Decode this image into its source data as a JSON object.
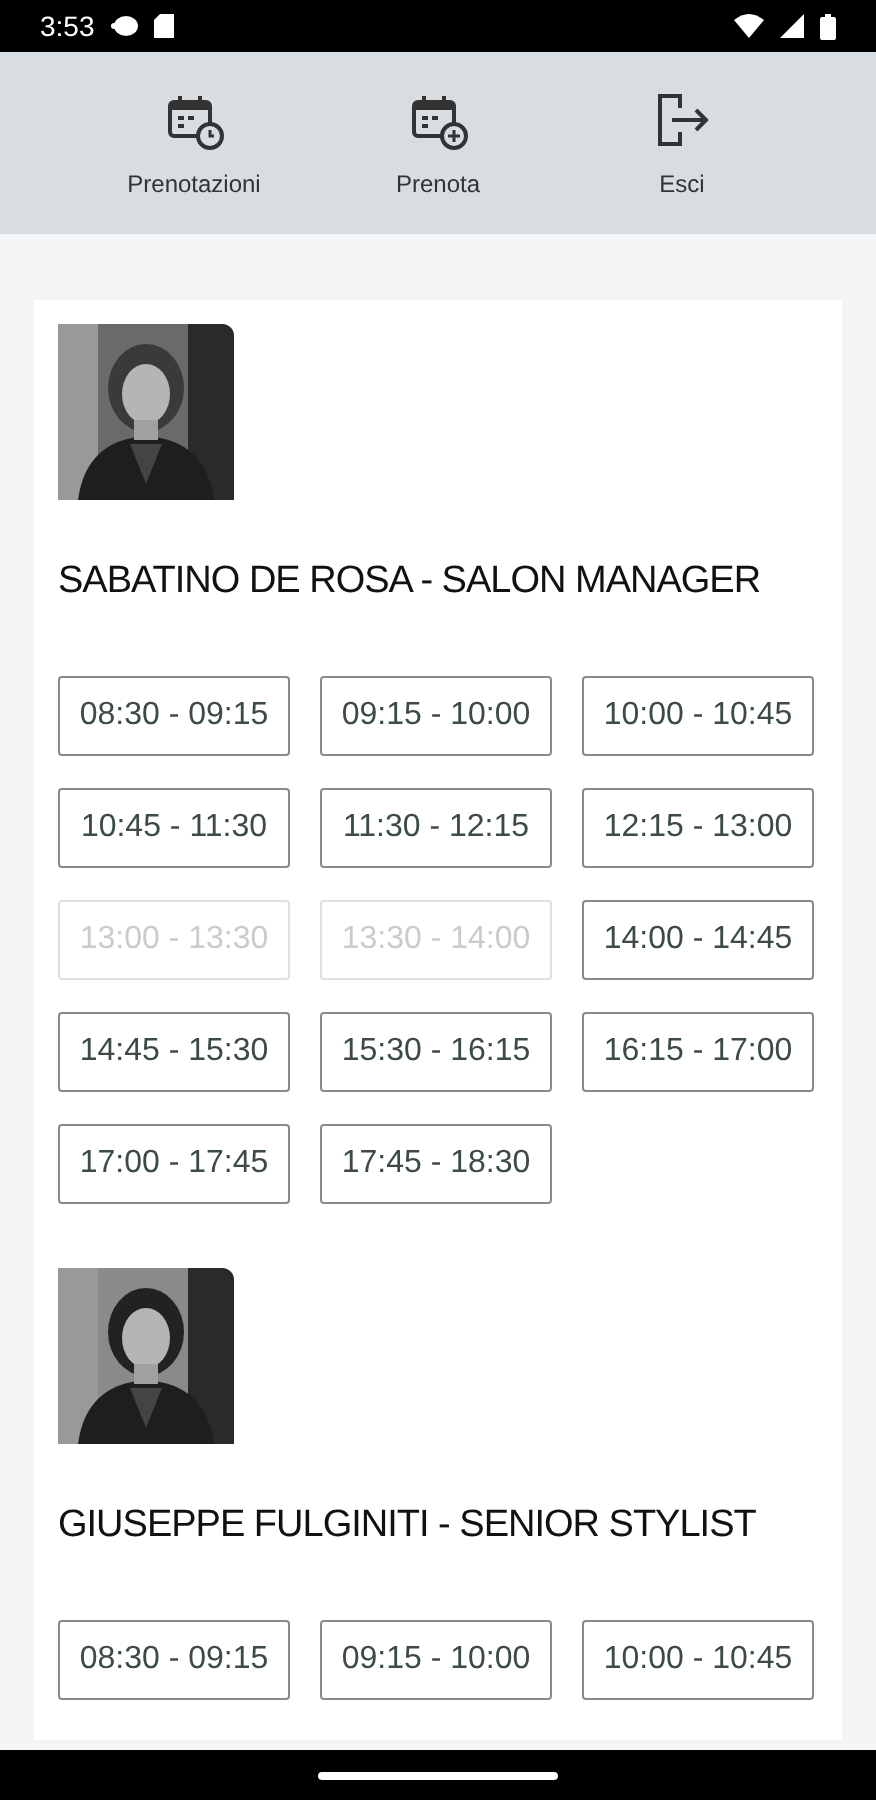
{
  "status_bar": {
    "time": "3:53"
  },
  "nav": [
    {
      "label": "Prenotazioni",
      "kind": "bookings"
    },
    {
      "label": "Prenota",
      "kind": "book"
    },
    {
      "label": "Esci",
      "kind": "logout"
    }
  ],
  "stylists": [
    {
      "name": "SABATINO DE ROSA - SALON MANAGER",
      "slots": [
        {
          "label": "08:30 - 09:15",
          "disabled": false
        },
        {
          "label": "09:15 - 10:00",
          "disabled": false
        },
        {
          "label": "10:00 - 10:45",
          "disabled": false
        },
        {
          "label": "10:45 - 11:30",
          "disabled": false
        },
        {
          "label": "11:30 - 12:15",
          "disabled": false
        },
        {
          "label": "12:15 - 13:00",
          "disabled": false
        },
        {
          "label": "13:00 - 13:30",
          "disabled": true
        },
        {
          "label": "13:30 - 14:00",
          "disabled": true
        },
        {
          "label": "14:00 - 14:45",
          "disabled": false
        },
        {
          "label": "14:45 - 15:30",
          "disabled": false
        },
        {
          "label": "15:30 - 16:15",
          "disabled": false
        },
        {
          "label": "16:15 - 17:00",
          "disabled": false
        },
        {
          "label": "17:00 - 17:45",
          "disabled": false
        },
        {
          "label": "17:45 - 18:30",
          "disabled": false
        }
      ]
    },
    {
      "name": "GIUSEPPE FULGINITI - SENIOR STYLIST",
      "slots": [
        {
          "label": "08:30 - 09:15",
          "disabled": false
        },
        {
          "label": "09:15 - 10:00",
          "disabled": false
        },
        {
          "label": "10:00 - 10:45",
          "disabled": false
        }
      ]
    }
  ]
}
